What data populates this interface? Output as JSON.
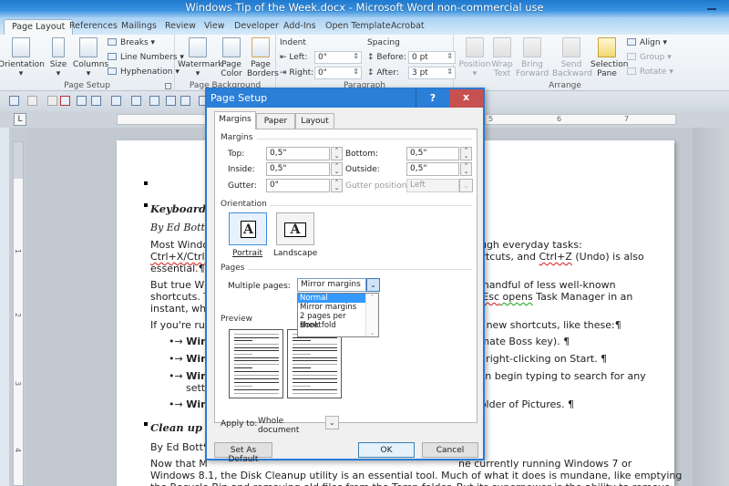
{
  "window": {
    "title": "Windows Tip of the Week.docx - Microsoft Word non-commercial use"
  },
  "ribbon_tabs": [
    "Page Layout",
    "References",
    "Mailings",
    "Review",
    "View",
    "Developer",
    "Add-Ins",
    "Open Template",
    "Acrobat"
  ],
  "ribbon": {
    "page_setup": {
      "label": "Page Setup",
      "orientation": "Orientation",
      "size": "Size",
      "columns": "Columns",
      "breaks": "Breaks",
      "line_numbers": "Line Numbers",
      "hyphenation": "Hyphenation"
    },
    "page_background": {
      "label": "Page Background",
      "watermark": "Watermark",
      "page_color": "Page Color",
      "page_borders": "Page Borders"
    },
    "paragraph": {
      "label": "Paragraph",
      "indent_label": "Indent",
      "left_label": "Left:",
      "left_value": "0\"",
      "right_label": "Right:",
      "right_value": "0\"",
      "spacing_label": "Spacing",
      "before_label": "Before:",
      "before_value": "0 pt",
      "after_label": "After:",
      "after_value": "3 pt"
    },
    "arrange": {
      "label": "Arrange",
      "position": "Position",
      "wrap_text": "Wrap Text",
      "bring_forward": "Bring Forward",
      "send_backward": "Send Backward",
      "selection_pane": "Selection Pane",
      "align": "Align",
      "group": "Group",
      "rotate": "Rotate"
    }
  },
  "rulers": {
    "tab_selector": "L",
    "h_numbers": [
      "5",
      "6",
      "7"
    ],
    "v_numbers": [
      "1",
      "2",
      "3",
      "4"
    ]
  },
  "document": {
    "heading1": "Keyboard s",
    "byline1": "By Ed Bott¶",
    "p1_l1a": "Most Windo",
    "p1_l1b": "hrough everyday tasks:",
    "p1_l2a": "Ctrl+X/Ctrl-",
    "p1_l2b": "shortcuts, and ",
    "p1_l2c": "Ctrl+Z",
    "p1_l2d": " (Undo) is also",
    "p1_l3": "essential.¶",
    "p2_l1a": "But true Wi",
    "p2_l1b": "g a handful of less well-known",
    "p2_l2a": "shortcuts. T",
    "p2_l2b": "ift+Esc",
    "p2_l2c": " opens",
    "p2_l2d": " Task Manager in an",
    "p2_l3": "instant, whi",
    "p3a": "If you're ru",
    "p3b": "n of new shortcuts, like these:¶",
    "bullets": [
      {
        "a": "Win",
        "b": " ultimate Boss key). ¶"
      },
      {
        "a": "Win",
        "b": "han right-clicking on Start. ¶"
      },
      {
        "a": "Win",
        "b": "u can begin typing to search for any",
        "c": "setti"
      },
      {
        "a": "Win",
        "b": "ubfolder of Pictures. ¶"
      }
    ],
    "bullet_prefix": "•→ ",
    "heading2": "Clean up yo",
    "byline2": "By Ed Bott¶",
    "p4_l1a": "Now that M",
    "p4_l1b": "ne currently running Windows 7 or",
    "p4_l2": "Windows 8.1, the Disk Cleanup utility is an essential tool. Much of what it does is mundane, like emptying",
    "p4_l3": "the Recycle Bin and removing old files from the Temp folder. But its superpower is the ability to remove"
  },
  "dialog": {
    "title": "Page Setup",
    "help": "?",
    "close": "x",
    "tabs": [
      "Margins",
      "Paper",
      "Layout"
    ],
    "active_tab": "Margins",
    "margins_section": "Margins",
    "top_label": "Top:",
    "top_value": "0,5\"",
    "bottom_label": "Bottom:",
    "bottom_value": "0,5\"",
    "inside_label": "Inside:",
    "inside_value": "0,5\"",
    "outside_label": "Outside:",
    "outside_value": "0,5\"",
    "gutter_label": "Gutter:",
    "gutter_value": "0\"",
    "gutter_position_label": "Gutter position:",
    "gutter_position_value": "Left",
    "orientation_section": "Orientation",
    "portrait": "Portrait",
    "landscape": "Landscape",
    "orientation_glyph": "A",
    "pages_section": "Pages",
    "multiple_pages_label": "Multiple pages:",
    "multiple_pages_value": "Mirror margins",
    "multiple_pages_options": [
      "Normal",
      "Mirror margins",
      "2 pages per sheet",
      "Book fold"
    ],
    "highlighted_option": "Normal",
    "preview_section": "Preview",
    "apply_to_label": "Apply to:",
    "apply_to_value": "Whole document",
    "set_default": "Set As Default",
    "ok": "OK",
    "cancel": "Cancel"
  },
  "colors": {
    "title_bar": "#2b7fd6",
    "close_button": "#c75050",
    "selection": "#3399ff"
  }
}
